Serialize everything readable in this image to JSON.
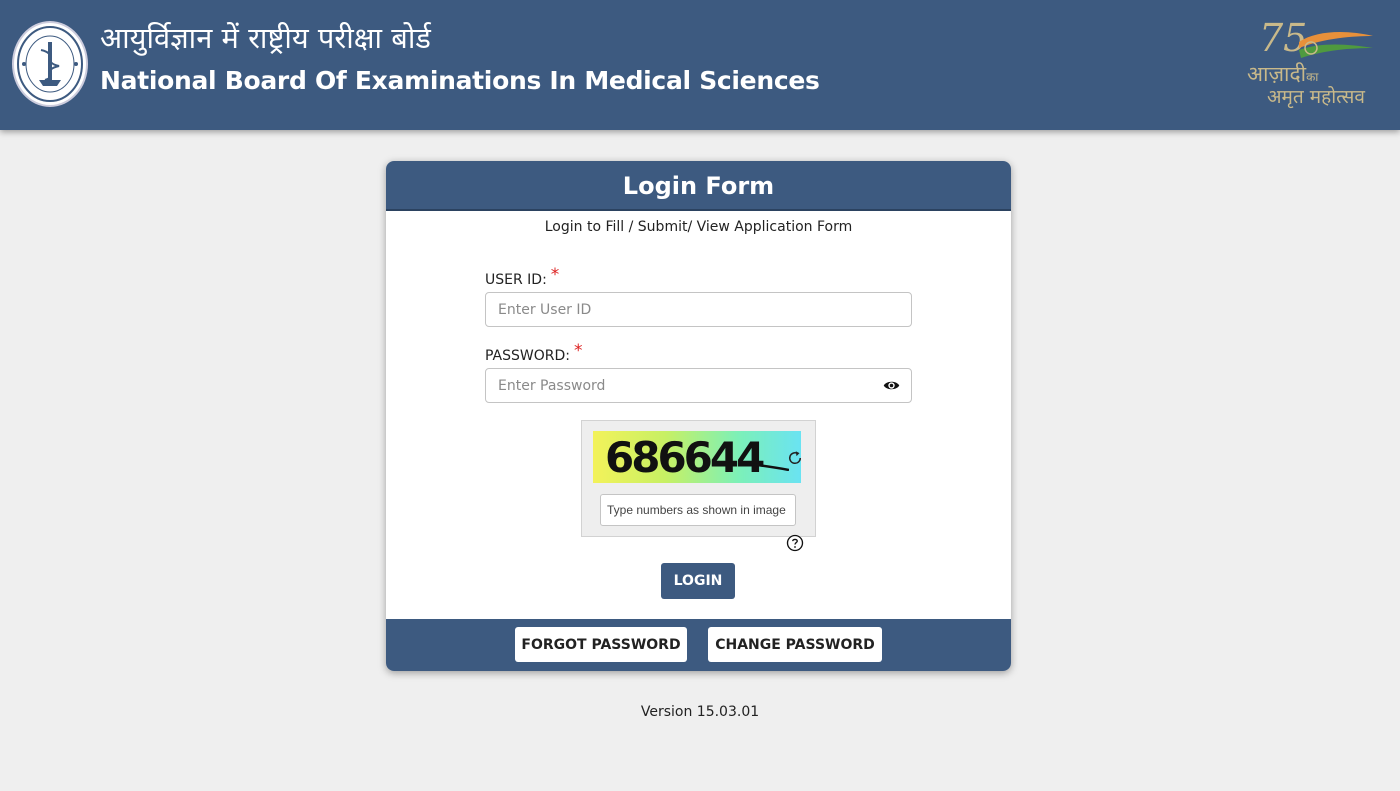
{
  "header": {
    "title_hindi": "आयुर्विज्ञान में राष्ट्रीय परीक्षा बोर्ड",
    "title_english": "National Board Of Examinations In Medical Sciences",
    "azadi_number": "75",
    "azadi_line1": "आज़ादी",
    "azadi_line1_small": "का",
    "azadi_line2": "अमृत महोत्सव"
  },
  "login_form": {
    "title": "Login Form",
    "subtitle": "Login to Fill / Submit/ View Application Form",
    "user_id_label": "USER ID:",
    "user_id_placeholder": "Enter User ID",
    "password_label": "PASSWORD:",
    "password_placeholder": "Enter Password",
    "required_mark": "*",
    "captcha_code": "686644",
    "captcha_placeholder": "Type numbers as shown in image",
    "login_label": "LOGIN",
    "forgot_password_label": "FORGOT PASSWORD",
    "change_password_label": "CHANGE PASSWORD"
  },
  "footer": {
    "version": "Version 15.03.01"
  },
  "colors": {
    "primary": "#3d5a80",
    "background": "#efefef",
    "required": "#dd2222"
  },
  "icons": {
    "seal": "nbems-seal-logo",
    "eye": "eye-icon",
    "refresh": "refresh-icon",
    "help": "help-circle-icon",
    "azadi": "azadi-ka-amrit-mahotsav-logo"
  }
}
